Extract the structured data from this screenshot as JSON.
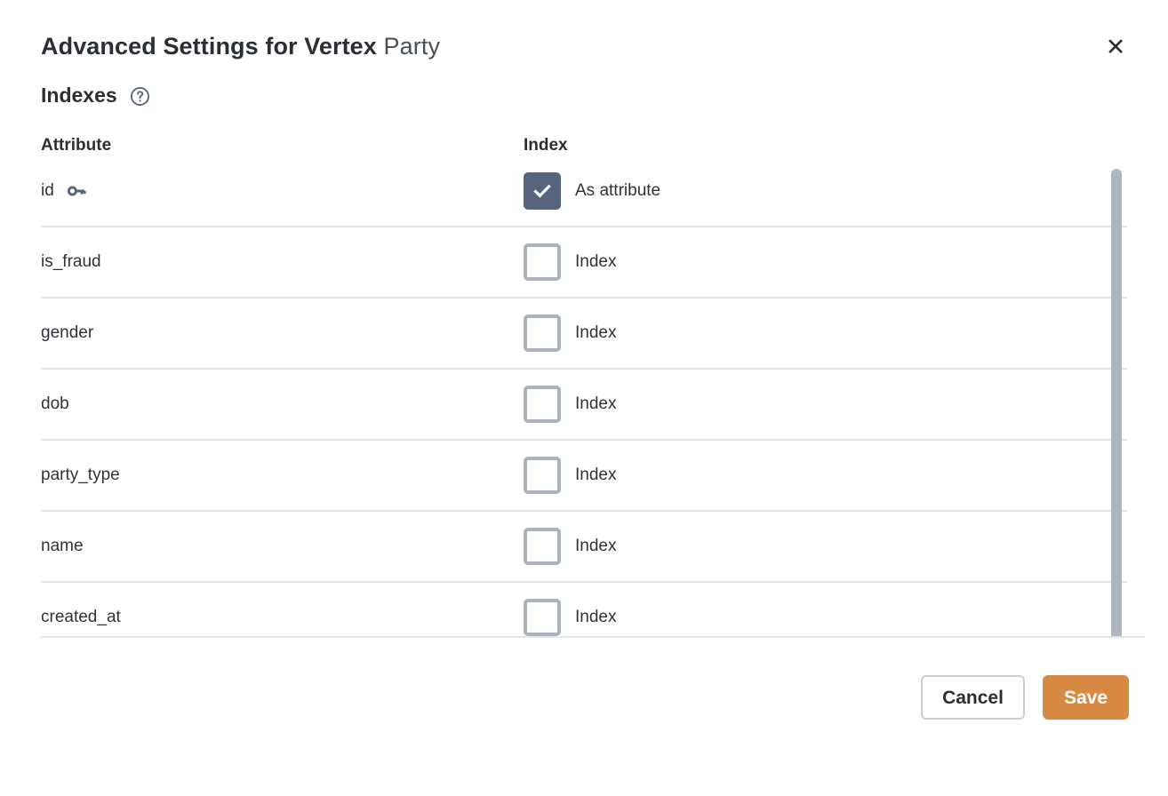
{
  "dialog": {
    "title_bold": "Advanced Settings for Vertex",
    "title_light": "Party",
    "close_icon": "close-icon",
    "close_glyph": "✕"
  },
  "section": {
    "title": "Indexes",
    "help_icon": "help-circle-icon"
  },
  "table": {
    "headers": {
      "attribute": "Attribute",
      "index": "Index"
    },
    "rows": [
      {
        "attribute": "id",
        "icon": "key-icon",
        "checked": true,
        "label": "As attribute"
      },
      {
        "attribute": "is_fraud",
        "icon": "",
        "checked": false,
        "label": "Index"
      },
      {
        "attribute": "gender",
        "icon": "",
        "checked": false,
        "label": "Index"
      },
      {
        "attribute": "dob",
        "icon": "",
        "checked": false,
        "label": "Index"
      },
      {
        "attribute": "party_type",
        "icon": "",
        "checked": false,
        "label": "Index"
      },
      {
        "attribute": "name",
        "icon": "",
        "checked": false,
        "label": "Index"
      },
      {
        "attribute": "created_at",
        "icon": "",
        "checked": false,
        "label": "Index"
      }
    ]
  },
  "footer": {
    "cancel_label": "Cancel",
    "save_label": "Save"
  },
  "colors": {
    "checkbox_checked": "#56657d",
    "checkbox_border": "#aab2bd",
    "save_button": "#d98a42",
    "scrollbar": "#aeb6c0",
    "divider": "#e4e5e7",
    "icon_slate": "#56657d"
  }
}
